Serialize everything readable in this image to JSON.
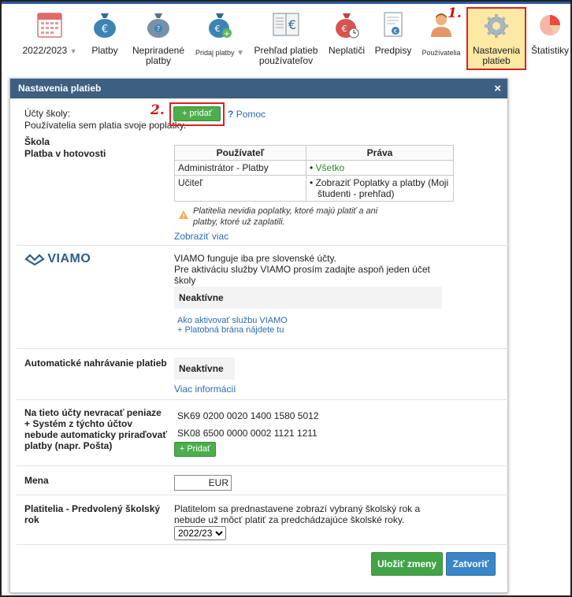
{
  "toolbar": {
    "year": "2022/2023",
    "items": [
      {
        "label": "Platby"
      },
      {
        "label": "Nepriradené platby"
      },
      {
        "label": "Pridaj platby"
      },
      {
        "label": "Prehľad platieb používateľov"
      },
      {
        "label": "Neplatiči"
      },
      {
        "label": "Predpisy"
      },
      {
        "label": "Používatelia"
      },
      {
        "label": "Nastavenia platieb"
      },
      {
        "label": "Štatistiky"
      }
    ],
    "step1": "1.",
    "step2": "2."
  },
  "dialog": {
    "title": "Nastavenia platieb",
    "close": "×",
    "school_accounts": {
      "label": "Účty školy:",
      "hint": "Používatelia sem platia svoje poplatky.",
      "add": "+ pridať",
      "help": "Pomoc"
    },
    "school": {
      "name": "Škola",
      "payment": "Platba v hotovosti",
      "table": {
        "headers": [
          "Používateľ",
          "Práva"
        ],
        "rows": [
          {
            "user": "Administrátor - Platby",
            "rights": "Všetko"
          },
          {
            "user": "Učiteľ",
            "rights": "Zobraziť Poplatky a platby (Moji študenti - prehľad)"
          }
        ]
      },
      "warning": "Platitelia nevidia poplatky, ktoré majú platiť a ani platby, ktoré už zaplatili.",
      "more": "Zobraziť viac"
    },
    "viamo": {
      "logo": "VIAMO",
      "line1": "VIAMO funguje iba pre slovenské účty.",
      "line2": "Pre aktiváciu služby VIAMO prosím zadajte aspoň jeden účet školy",
      "status": "Neaktívne",
      "link": "Ako aktivovať službu VIAMO + Platobná brána nájdete tu"
    },
    "auto": {
      "label": "Automatické nahrávanie platieb",
      "status": "Neaktívne",
      "link": "Viac informácií"
    },
    "norefund": {
      "label": "Na tieto účty nevracať peniaze + Systém z týchto účtov nebude automaticky priraďovať platby (napr. Pošta)",
      "accounts": [
        "SK69 0200 0020 1400 1580 5012",
        "SK08 6500 0000 0002 1121 1211"
      ],
      "add": "+ Pridať"
    },
    "currency": {
      "label": "Mena",
      "value": "EUR"
    },
    "year": {
      "label": "Platitelia - Predvolený školský rok",
      "desc": "Platitelom sa prednastavene zobrazí vybraný školský rok a nebude už môcť platiť za predchádzajúce školské roky.",
      "selected": "2022/23"
    },
    "save": "Uložiť zmeny",
    "close_btn": "Zatvoriť"
  },
  "colors": {
    "header": "#3d5f82",
    "green": "#43a347",
    "blue": "#3a85c7",
    "highlight": "#e02020",
    "active_bg": "#fbe9a4"
  }
}
